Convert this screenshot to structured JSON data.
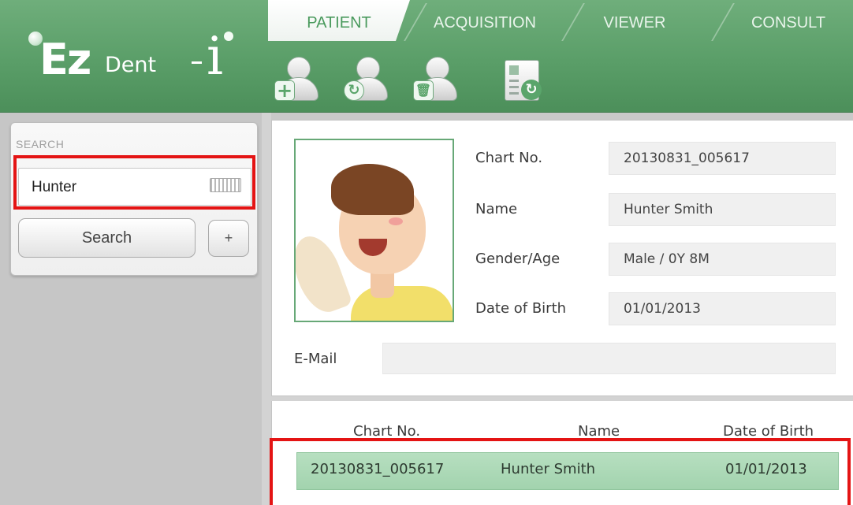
{
  "app": {
    "logo_text": "EZ Dent-i"
  },
  "tabs": [
    {
      "label": "PATIENT",
      "active": true
    },
    {
      "label": "ACQUISITION",
      "active": false
    },
    {
      "label": "VIEWER",
      "active": false
    },
    {
      "label": "CONSULT",
      "active": false
    }
  ],
  "toolbar": [
    {
      "icon": "add-patient-icon"
    },
    {
      "icon": "modify-patient-icon"
    },
    {
      "icon": "delete-patient-icon"
    },
    {
      "icon": "patient-card-refresh-icon"
    }
  ],
  "search": {
    "title": "SEARCH",
    "value": "Hunter",
    "button_label": "Search",
    "plus_label": "+"
  },
  "patient": {
    "labels": {
      "chart_no": "Chart No.",
      "name": "Name",
      "gender_age": "Gender/Age",
      "dob": "Date of Birth",
      "email": "E-Mail"
    },
    "values": {
      "chart_no": "20130831_005617",
      "name": "Hunter Smith",
      "gender_age": "Male / 0Y 8M",
      "dob": "01/01/2013",
      "email": ""
    }
  },
  "results": {
    "columns": [
      "Chart No.",
      "Name",
      "Date of Birth"
    ],
    "rows": [
      {
        "chart_no": "20130831_005617",
        "name": "Hunter Smith",
        "dob": "01/01/2013",
        "selected": true
      }
    ]
  },
  "colors": {
    "brand_green": "#5a9e68",
    "highlight_red": "#e41414",
    "selected_row": "#a8d8b4"
  }
}
